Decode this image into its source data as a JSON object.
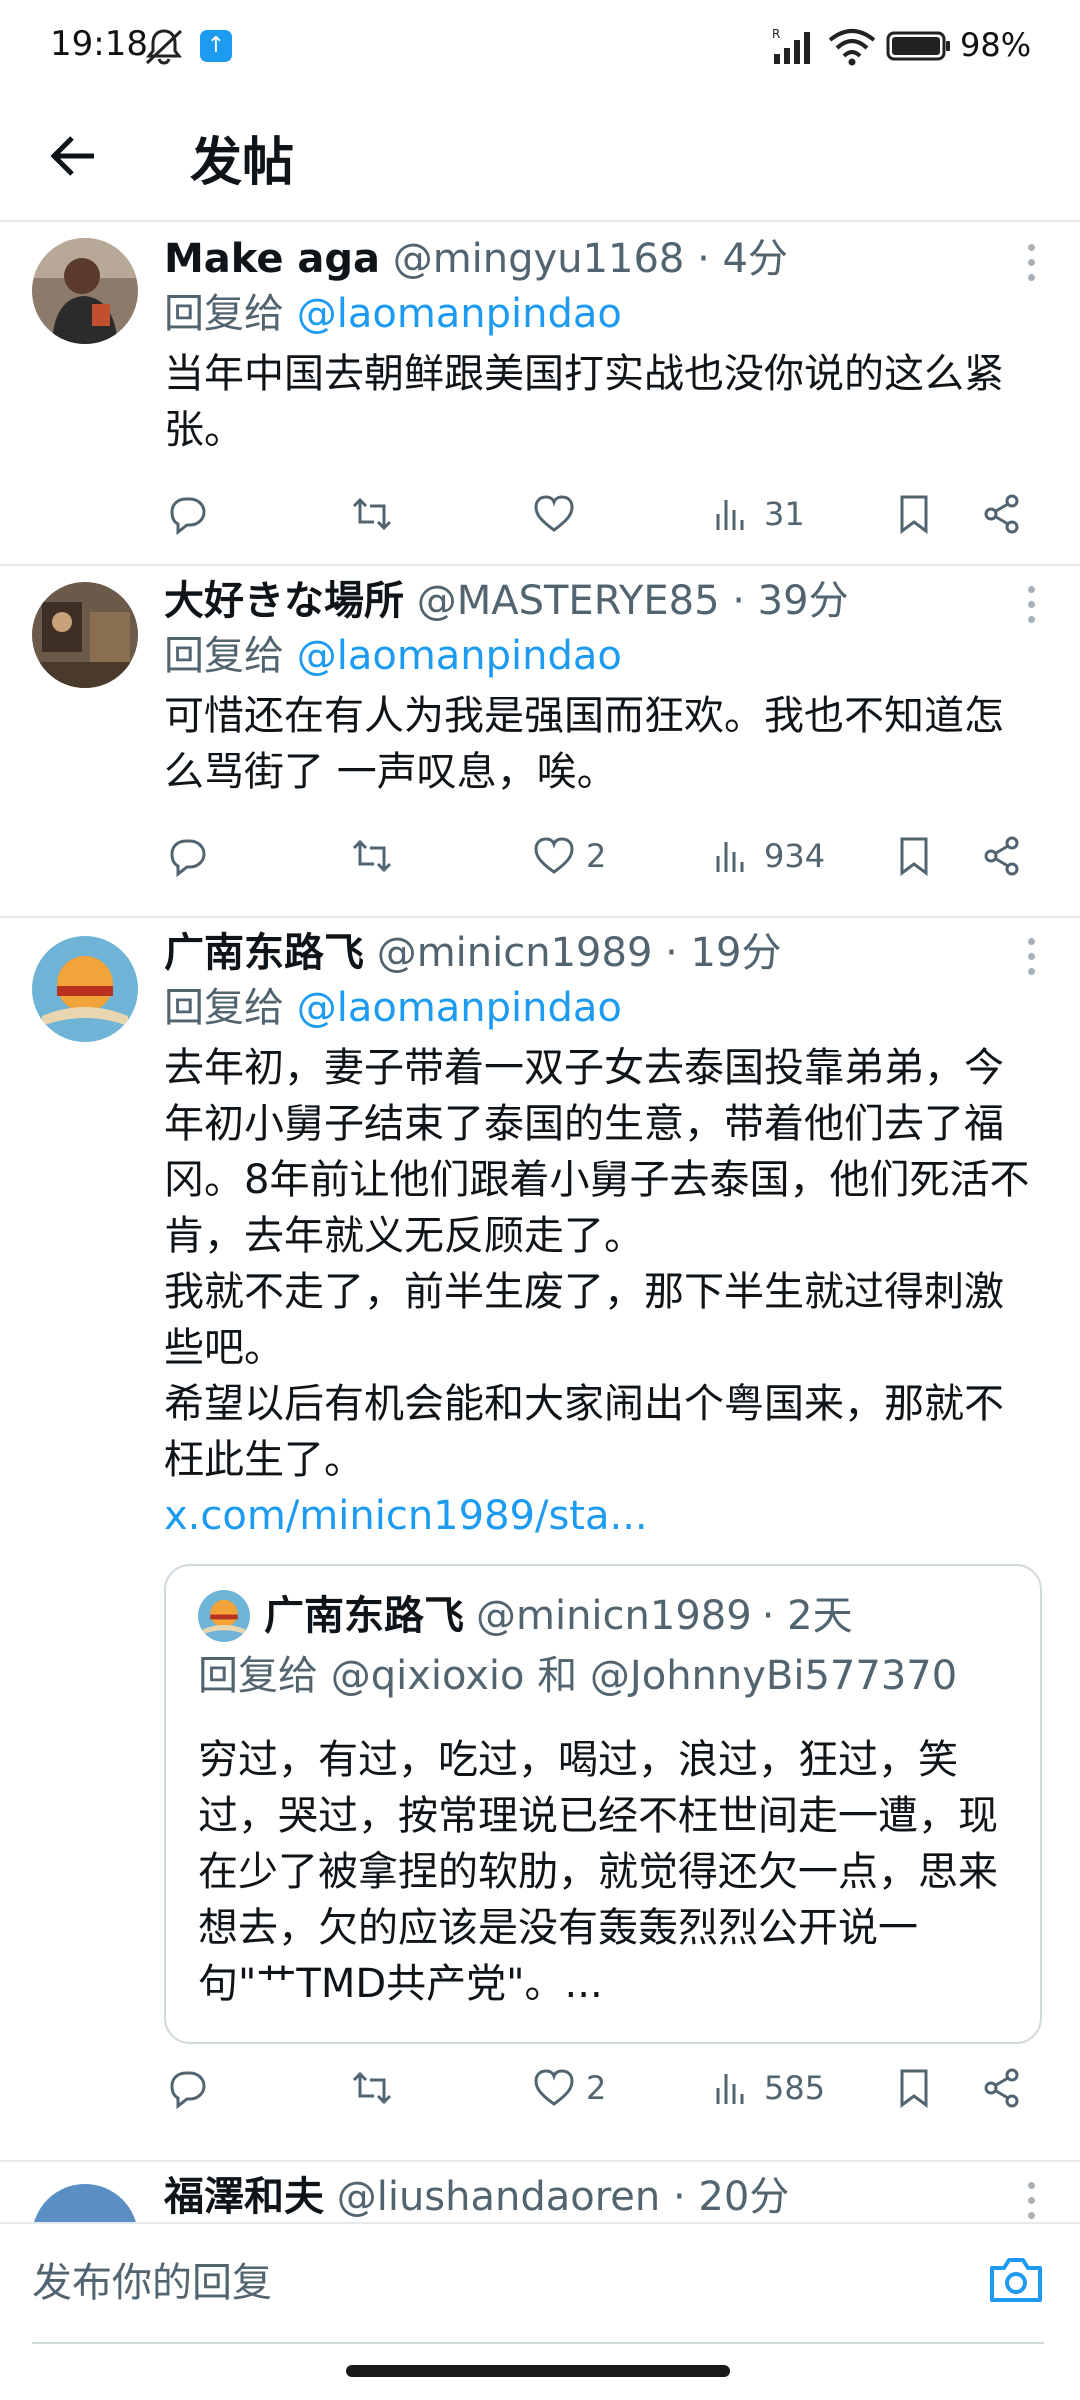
{
  "status_bar": {
    "time": "19:18",
    "battery": "98%",
    "app_badge": "↑"
  },
  "header": {
    "title": "发帖"
  },
  "tweets": [
    {
      "name": "Make aga",
      "handle": "@mingyu1168",
      "time": "· 4分",
      "reply_prefix": "回复给",
      "reply_to": "@laomanpindao",
      "text": "当年中国去朝鲜跟美国打实战也没你说的这么紧张。",
      "likes": "",
      "views": "31"
    },
    {
      "name": "大好きな場所",
      "handle": "@MASTERYE85",
      "time": "· 39分",
      "reply_prefix": "回复给",
      "reply_to": "@laomanpindao",
      "text": "可惜还在有人为我是强国而狂欢。我也不知道怎么骂街了 一声叹息，唉。",
      "likes": "2",
      "views": "934"
    },
    {
      "name": "广南东路飞",
      "handle": "@minicn1989",
      "time": "· 19分",
      "reply_prefix": "回复给",
      "reply_to": "@laomanpindao",
      "text_lines": [
        "去年初，妻子带着一双子女去泰国投靠弟弟，今年初小舅子结束了泰国的生意，带着他们去了福冈。8年前让他们跟着小舅子去泰国，他们死活不肯，去年就义无反顾走了。",
        "我就不走了，前半生废了，那下半生就过得刺激些吧。",
        "希望以后有机会能和大家闹出个粤国来，那就不枉此生了。"
      ],
      "link": "x.com/minicn1989/sta...",
      "quote": {
        "name": "广南东路飞",
        "handle": "@minicn1989",
        "time": "· 2天",
        "reply_line": "回复给 @qixioxio 和 @JohnnyBi577370",
        "text": "穷过，有过，吃过，喝过，浪过，狂过，笑过，哭过，按常理说已经不枉世间走一遭，现在少了被拿捏的软肋，就觉得还欠一点，思来想去，欠的应该是没有轰轰烈烈公开说一句\"艹TMD共产党\"。..."
      },
      "likes": "2",
      "views": "585"
    },
    {
      "name": "福澤和夫",
      "handle": "@liushandaoren",
      "time": "· 20分"
    }
  ],
  "reply_bar": {
    "placeholder": "发布你的回复"
  },
  "colors": {
    "accent": "#1d9bf0",
    "muted": "#536471",
    "divider": "#e6e9ec"
  },
  "icons": [
    "back-arrow-icon",
    "reply-icon",
    "retweet-icon",
    "heart-icon",
    "views-icon",
    "bookmark-icon",
    "share-icon",
    "more-icon",
    "camera-icon"
  ]
}
